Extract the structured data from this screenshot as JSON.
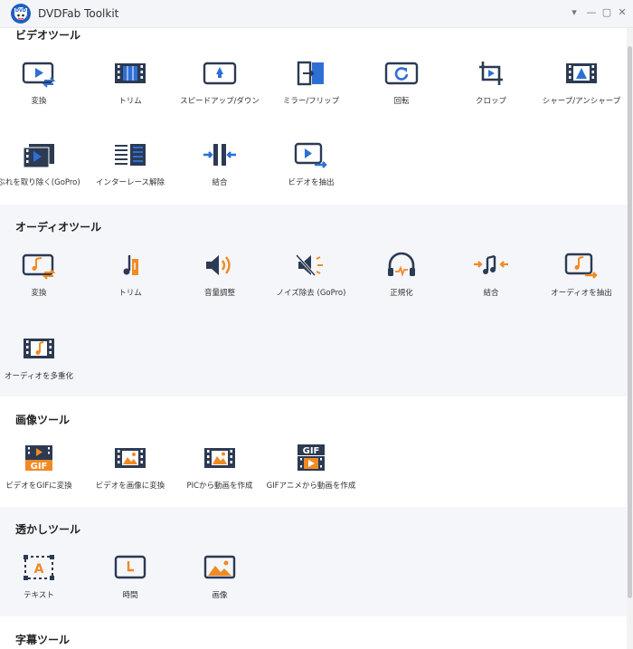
{
  "window": {
    "title": "DVDFab Toolkit",
    "controls": {
      "menu": "▾",
      "minimize": "—",
      "maximize": "▢",
      "close": "✕"
    }
  },
  "colors": {
    "accent_blue": "#2e6fd6",
    "accent_orange": "#f08a24",
    "icon_dark": "#2c3a52",
    "shade": "#f4f6fa"
  },
  "sections": {
    "video": {
      "title": "ビデオツール",
      "tools": [
        {
          "icon": "convert-icon",
          "label": "変換"
        },
        {
          "icon": "trim-icon",
          "label": "トリム"
        },
        {
          "icon": "speed-icon",
          "label": "スピードアップ/ダウン"
        },
        {
          "icon": "mirror-icon",
          "label": "ミラー/フリップ"
        },
        {
          "icon": "rotate-icon",
          "label": "回転"
        },
        {
          "icon": "crop-icon",
          "label": "クロップ"
        },
        {
          "icon": "sharpen-icon",
          "label": "シャープ/アンシャープ"
        },
        {
          "icon": "stabilize-icon",
          "label": "ぶれを取り除く(GoPro)"
        },
        {
          "icon": "deinterlace-icon",
          "label": "インターレース解除"
        },
        {
          "icon": "merge-icon",
          "label": "結合"
        },
        {
          "icon": "extract-video-icon",
          "label": "ビデオを抽出"
        }
      ]
    },
    "audio": {
      "title": "オーディオツール",
      "tools": [
        {
          "icon": "audio-convert-icon",
          "label": "変換"
        },
        {
          "icon": "audio-trim-icon",
          "label": "トリム"
        },
        {
          "icon": "volume-icon",
          "label": "音量調整"
        },
        {
          "icon": "denoise-icon",
          "label": "ノイズ除去 (GoPro)"
        },
        {
          "icon": "normalize-icon",
          "label": "正規化"
        },
        {
          "icon": "audio-merge-icon",
          "label": "結合"
        },
        {
          "icon": "extract-audio-icon",
          "label": "オーディオを抽出"
        },
        {
          "icon": "multiplex-audio-icon",
          "label": "オーディオを多重化"
        }
      ]
    },
    "image": {
      "title": "画像ツール",
      "tools": [
        {
          "icon": "video-to-gif-icon",
          "label": "ビデオをGIFに変換"
        },
        {
          "icon": "video-to-image-icon",
          "label": "ビデオを画像に変換"
        },
        {
          "icon": "pic-to-video-icon",
          "label": "PICから動画を作成"
        },
        {
          "icon": "gif-to-video-icon",
          "label": "GIFアニメから動画を作成"
        }
      ]
    },
    "watermark": {
      "title": "透かしツール",
      "tools": [
        {
          "icon": "text-watermark-icon",
          "label": "テキスト"
        },
        {
          "icon": "time-watermark-icon",
          "label": "時間"
        },
        {
          "icon": "image-watermark-icon",
          "label": "画像"
        }
      ]
    },
    "subtitle": {
      "title": "字幕ツール"
    }
  }
}
